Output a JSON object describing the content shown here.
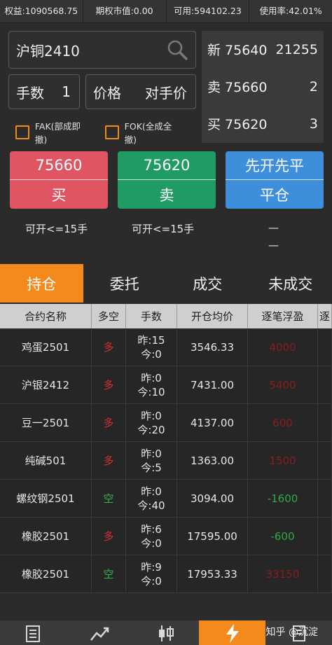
{
  "topbar": [
    {
      "label": "权益:1090568.75"
    },
    {
      "label": "期权市值:0.00"
    },
    {
      "label": "可用:594102.23"
    },
    {
      "label": "使用率:42.01%"
    }
  ],
  "order": {
    "contract": "沪铜2410",
    "qty_label": "手数",
    "qty_value": "1",
    "price_label": "价格",
    "price_value": "对手价",
    "fak_label": "FAK(部成即撤)",
    "fok_label": "FOK(全成全撤)"
  },
  "quote": [
    {
      "label": "新 75640",
      "value": "21255"
    },
    {
      "label": "卖 75660",
      "value": "2"
    },
    {
      "label": "买 75620",
      "value": "3"
    }
  ],
  "buttons": {
    "buy_price": "75660",
    "buy_label": "买",
    "sell_price": "75620",
    "sell_label": "卖",
    "close_top": "先开先平",
    "close_label": "平仓"
  },
  "hints": {
    "buy": "可开<=15手",
    "sell": "可开<=15手",
    "close1": "—",
    "close2": "—"
  },
  "tabs": [
    "持仓",
    "委托",
    "成交",
    "未成交"
  ],
  "table": {
    "headers": [
      "合约名称",
      "多空",
      "手数",
      "开仓均价",
      "逐笔浮盈",
      "逐"
    ],
    "rows": [
      {
        "name": "鸡蛋2501",
        "dir": "多",
        "dir_type": "long",
        "y": "昨:15",
        "t": "今:0",
        "avg": "3546.33",
        "pnl": "4000",
        "pnl_color": "#8a1c1c"
      },
      {
        "name": "沪银2412",
        "dir": "多",
        "dir_type": "long",
        "y": "昨:0",
        "t": "今:10",
        "avg": "7431.00",
        "pnl": "5400",
        "pnl_color": "#8a1c1c"
      },
      {
        "name": "豆一2501",
        "dir": "多",
        "dir_type": "long",
        "y": "昨:0",
        "t": "今:20",
        "avg": "4137.00",
        "pnl": "600",
        "pnl_color": "#8a1c1c"
      },
      {
        "name": "纯碱501",
        "dir": "多",
        "dir_type": "long",
        "y": "昨:0",
        "t": "今:5",
        "avg": "1363.00",
        "pnl": "1500",
        "pnl_color": "#8a1c1c"
      },
      {
        "name": "螺纹钢2501",
        "dir": "空",
        "dir_type": "short",
        "y": "昨:0",
        "t": "今:40",
        "avg": "3094.00",
        "pnl": "-1600",
        "pnl_color": "#2fa84a"
      },
      {
        "name": "橡胶2501",
        "dir": "多",
        "dir_type": "long",
        "y": "昨:6",
        "t": "今:0",
        "avg": "17595.00",
        "pnl": "-600",
        "pnl_color": "#2fa84a"
      },
      {
        "name": "橡胶2501",
        "dir": "空",
        "dir_type": "short",
        "y": "昨:9",
        "t": "今:0",
        "avg": "17953.33",
        "pnl": "33150",
        "pnl_color": "#8a1c1c"
      }
    ]
  },
  "footer": {
    "watermark": "知乎 @沉淀"
  }
}
